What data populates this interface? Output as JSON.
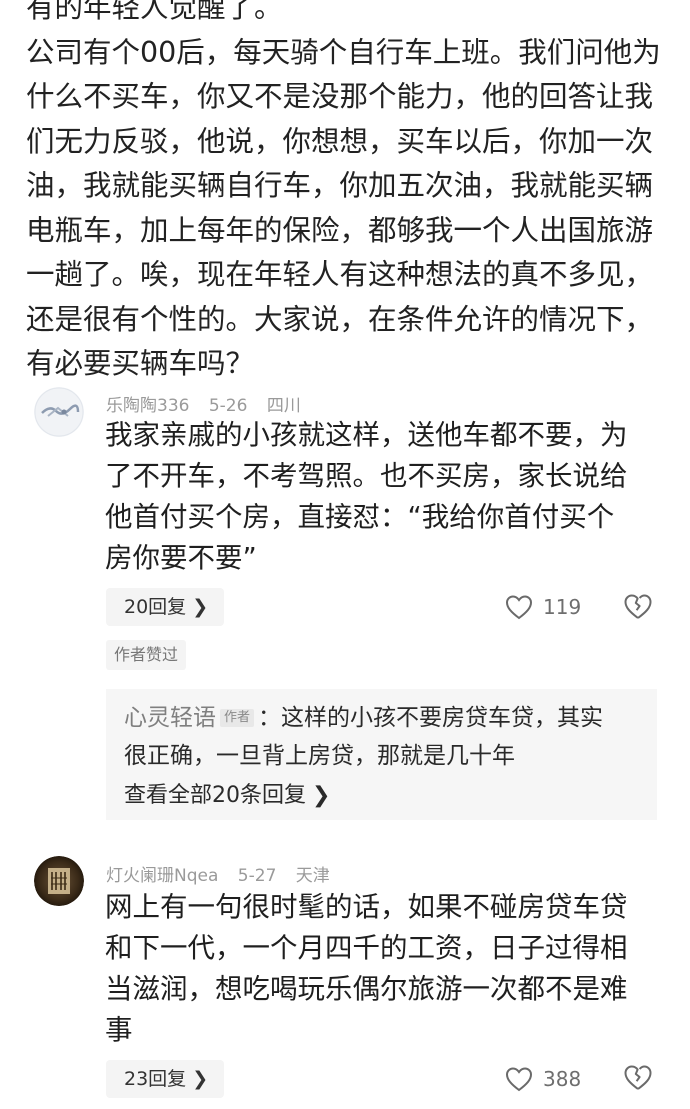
{
  "post": {
    "lines": [
      "有的年轻人觉醒了。",
      "公司有个00后，每天骑个自行车上班。我们问他为",
      "什么不买车，你又不是没那个能力，他的回答让我",
      "们无力反驳，他说，你想想，买车以后，你加一次",
      "油，我就能买辆自行车，你加五次油，我就能买辆",
      "电瓶车，加上每年的保险，都够我一个人出国旅游",
      "一趟了。唉，现在年轻人有这种想法的真不多见，",
      "还是很有个性的。大家说，在条件允许的情况下，",
      "有必要买辆车吗？"
    ]
  },
  "comments": [
    {
      "username": "乐陶陶336",
      "date": "5-26",
      "location": "四川",
      "lines": [
        "我家亲戚的小孩就这样，送他车都不要，为",
        "了不开车，不考驾照。也不买房，家长说给",
        "他首付买个房，直接怼：“我给你首付买个",
        "房你要不要”"
      ],
      "reply_count": "20回复",
      "likes": "119",
      "author_liked": "作者赞过",
      "sub_reply": {
        "author": "心灵轻语",
        "author_tag": "作者",
        "line1": "：这样的小孩不要房贷车贷，其实",
        "line2": "很正确，一旦背上房贷，那就是几十年",
        "view_all": "查看全部20条回复"
      }
    },
    {
      "username": "灯火阑珊Nqea",
      "date": "5-27",
      "location": "天津",
      "lines": [
        "网上有一句很时髦的话，如果不碰房贷车贷",
        "和下一代，一个月四千的工资，日子过得相",
        "当滋润，想吃喝玩乐偶尔旅游一次都不是难",
        "事"
      ],
      "reply_count": "23回复",
      "likes": "388"
    }
  ],
  "icons": {
    "reply_chevron": "chevron-right-icon",
    "like": "heart-icon",
    "dislike": "broken-heart-icon"
  },
  "colors": {
    "meta_text": "#9a9a9a",
    "button_bg": "#f4f4f4",
    "subreply_bg": "#f6f6f6"
  }
}
